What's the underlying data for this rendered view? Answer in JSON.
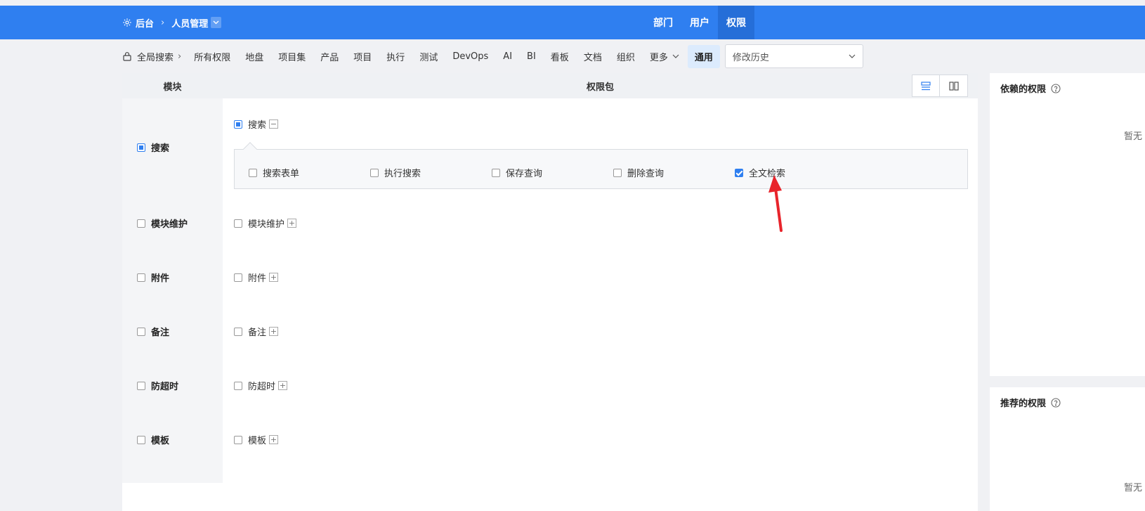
{
  "header": {
    "breadcrumb": {
      "root": "后台",
      "current": "人员管理"
    },
    "tabs": [
      {
        "label": "部门",
        "active": false
      },
      {
        "label": "用户",
        "active": false
      },
      {
        "label": "权限",
        "active": true
      }
    ],
    "color": "#2f7ff0"
  },
  "module_nav": {
    "global_search": "全局搜索",
    "items": [
      "所有权限",
      "地盘",
      "项目集",
      "产品",
      "项目",
      "执行",
      "测试",
      "DevOps",
      "AI",
      "BI",
      "看板",
      "文档",
      "组织"
    ],
    "more": "更多",
    "active": "通用",
    "history_select": {
      "value": "修改历史"
    }
  },
  "table": {
    "col_module": "模块",
    "col_package": "权限包",
    "modules": [
      {
        "name": "搜索",
        "state": "partial",
        "package": "搜索",
        "expanded": true
      },
      {
        "name": "模块维护",
        "state": "unchecked",
        "package": "模块维护",
        "expanded": false
      },
      {
        "name": "附件",
        "state": "unchecked",
        "package": "附件",
        "expanded": false
      },
      {
        "name": "备注",
        "state": "unchecked",
        "package": "备注",
        "expanded": false
      },
      {
        "name": "防超时",
        "state": "unchecked",
        "package": "防超时",
        "expanded": false
      },
      {
        "name": "模板",
        "state": "unchecked",
        "package": "模板",
        "expanded": false
      }
    ],
    "search_privileges": [
      {
        "label": "搜索表单",
        "checked": false
      },
      {
        "label": "执行搜索",
        "checked": false
      },
      {
        "label": "保存查询",
        "checked": false
      },
      {
        "label": "删除查询",
        "checked": false
      },
      {
        "label": "全文检索",
        "checked": true
      }
    ]
  },
  "side": {
    "depends": {
      "title": "依赖的权限",
      "empty": "暂无"
    },
    "recommends": {
      "title": "推荐的权限",
      "empty": "暂无"
    }
  },
  "annotation_color": "#e8242b"
}
